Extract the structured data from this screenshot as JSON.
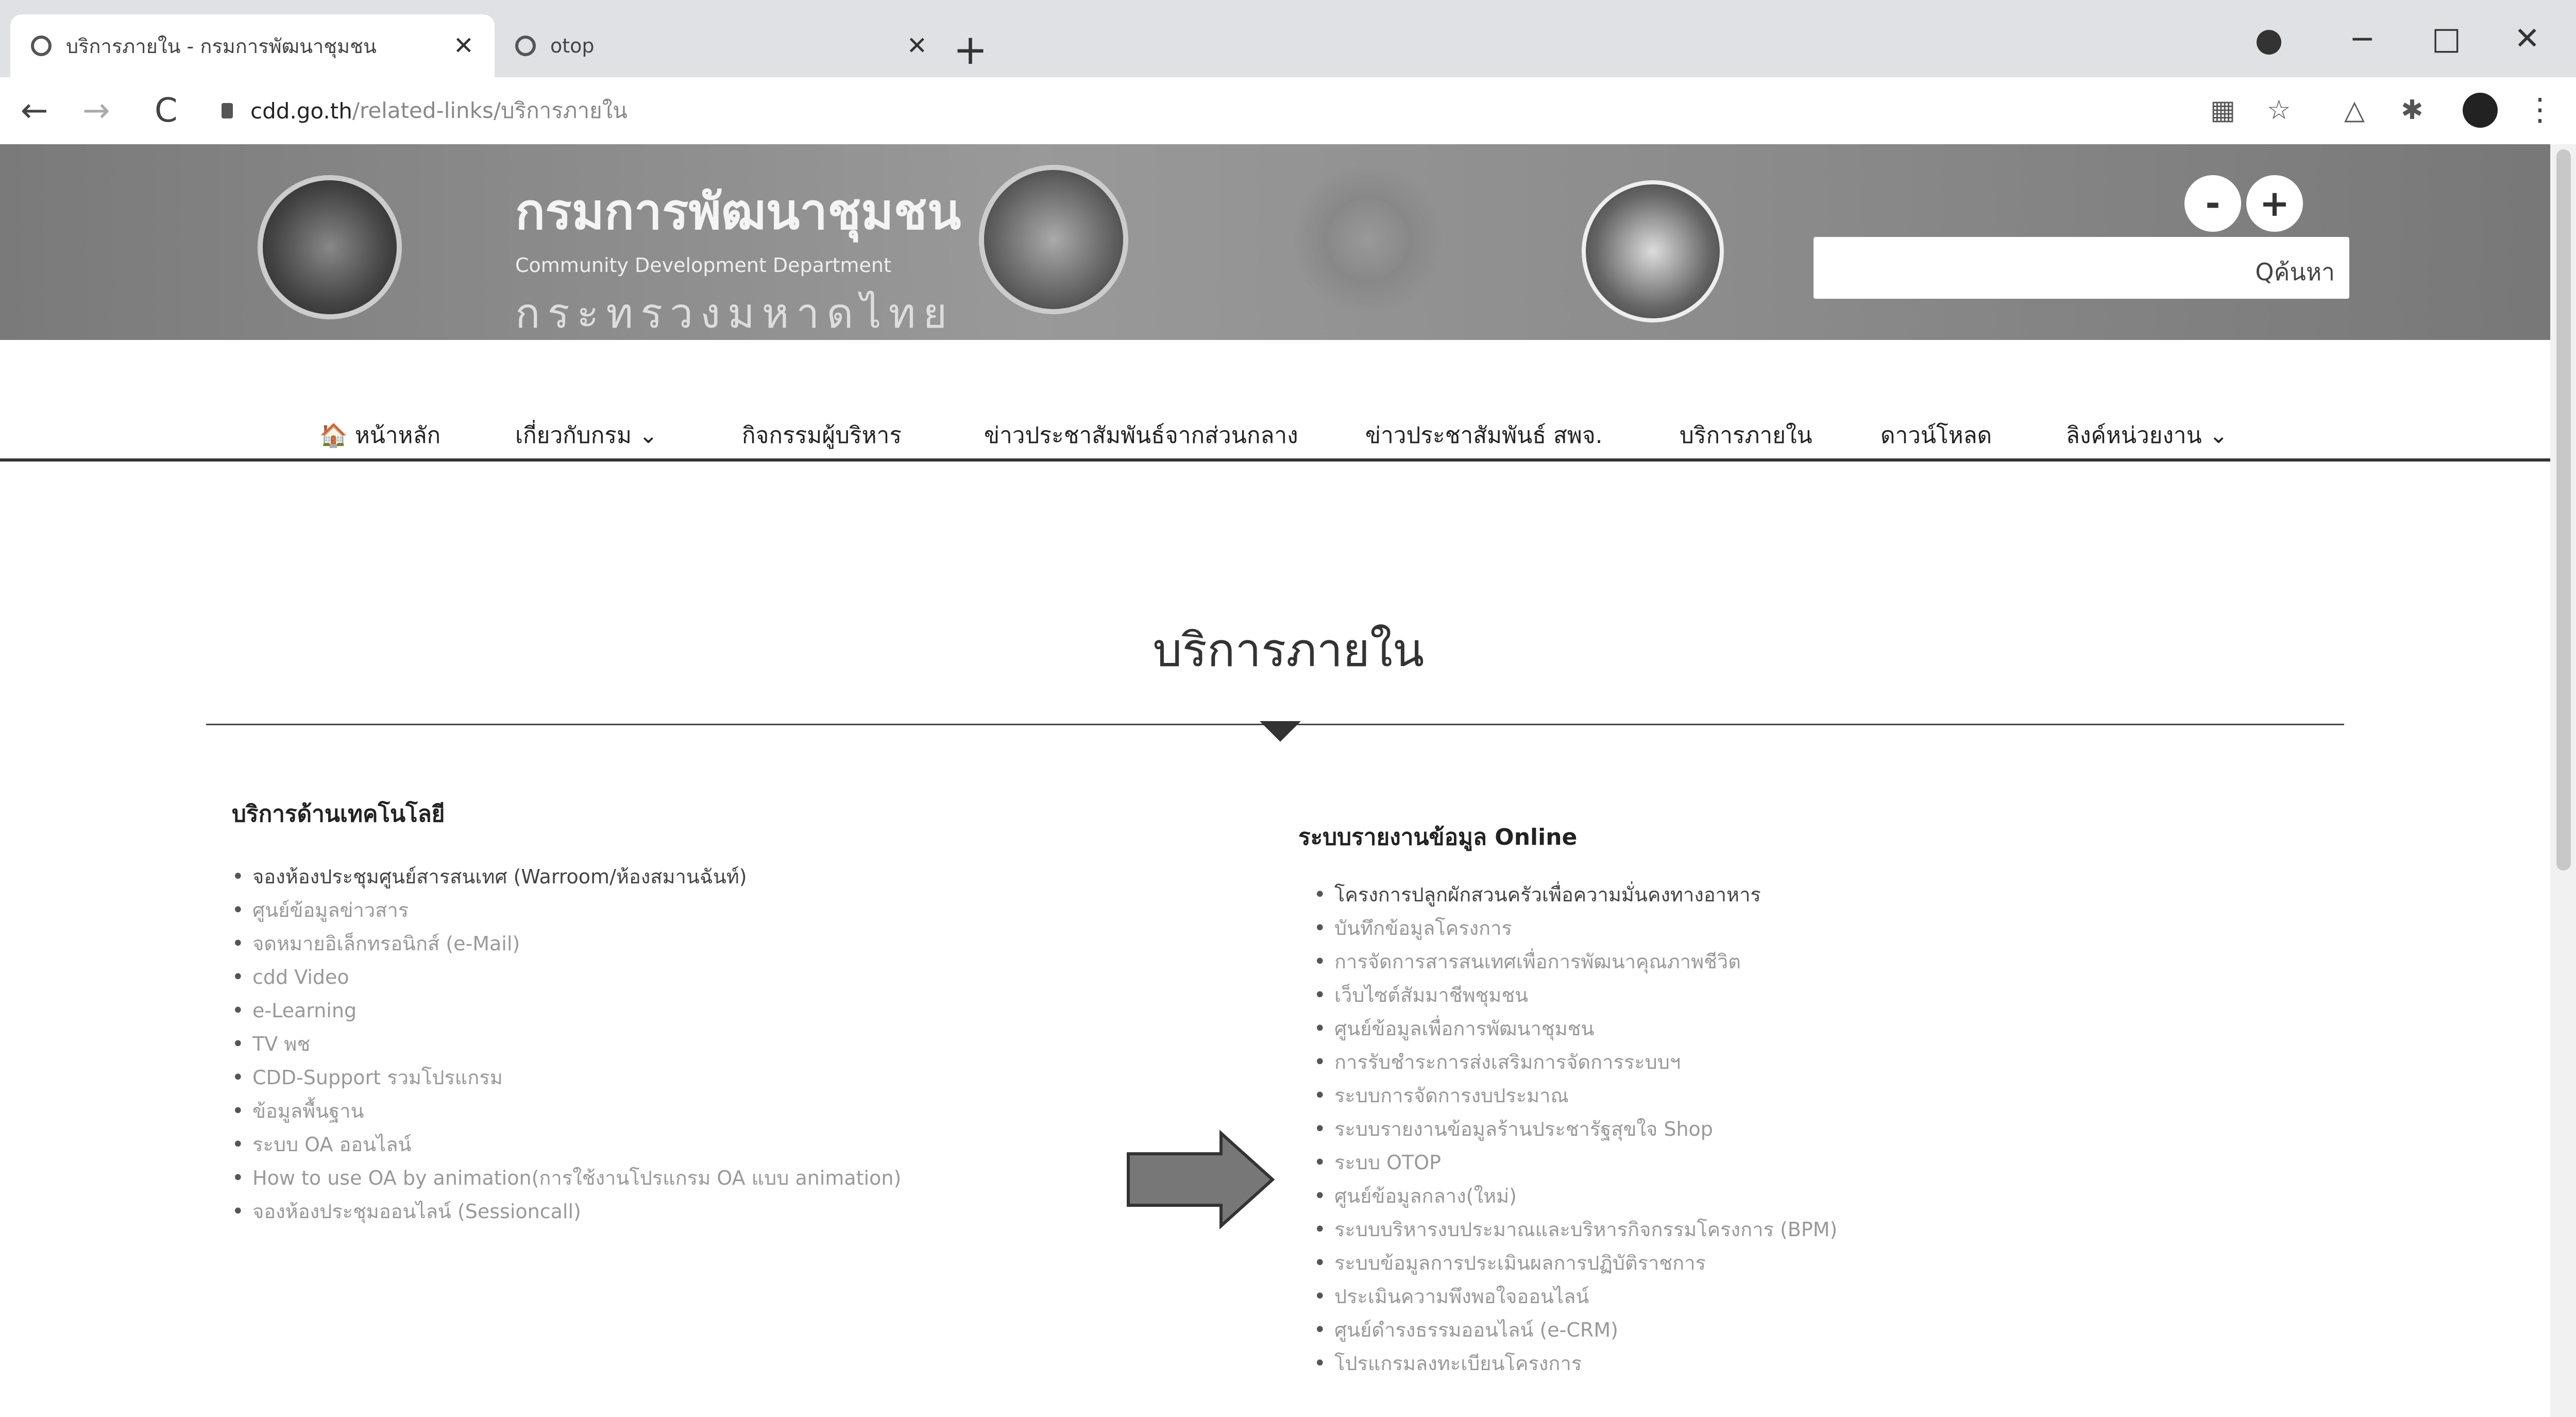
{
  "browser": {
    "tabs": [
      {
        "title": "บริการภายใน - กรมการพัฒนาชุมชน",
        "close": "✕"
      },
      {
        "title": "otop",
        "close": "✕"
      }
    ],
    "new_tab": "+",
    "url_host": "cdd.go.th",
    "url_path": "/related-links/บริการภายใน",
    "back": "←",
    "forward": "→",
    "reload": "C",
    "win_min": "−",
    "win_max": "□",
    "win_close": "✕",
    "menu": "⋮"
  },
  "header": {
    "org_name_th": "กรมการพัฒนาชุมชน",
    "org_name_en": "Community Development Department",
    "ministry": "กระทรวงมหาดไทย",
    "font_minus": "-",
    "font_plus": "+",
    "search_button": "Qค้นหา"
  },
  "nav": {
    "items": [
      "🏠 หน้าหลัก",
      "เกี่ยวกับกรม ⌄",
      "กิจกรรมผู้บริหาร",
      "ข่าวประชาสัมพันธ์จากส่วนกลาง",
      "ข่าวประชาสัมพันธ์ สพจ.",
      "บริการภายใน",
      "ดาวน์โหลด",
      "ลิงค์หน่วยงาน ⌄"
    ]
  },
  "page": {
    "title": "บริการภายใน",
    "left_section": {
      "heading": "บริการด้านเทคโนโลยี",
      "items": [
        "จองห้องประชุมศูนย์สารสนเทศ (Warroom/ห้องสมานฉันท์)",
        "ศูนย์ข้อมูลข่าวสาร",
        "จดหมายอิเล็กทรอนิกส์ (e-Mail)",
        "cdd Video",
        "e-Learning",
        "TV พช",
        "CDD-Support รวมโปรแกรม",
        "ข้อมูลพื้นฐาน",
        "ระบบ OA ออนไลน์",
        "How to use OA by animation(การใช้งานโปรแกรม OA แบบ animation)",
        "จองห้องประชุมออนไลน์ (Sessioncall)"
      ]
    },
    "right_section": {
      "heading": "ระบบรายงานข้อมูล Online",
      "items": [
        "โครงการปลูกผักสวนครัวเพื่อความมั่นคงทางอาหาร",
        "บันทึกข้อมูลโครงการ",
        "การจัดการสารสนเทศเพื่อการพัฒนาคุณภาพชีวิต",
        "เว็บไซต์สัมมาชีพชุมชน",
        "ศูนย์ข้อมูลเพื่อการพัฒนาชุมชน",
        "การรับชำระการส่งเสริมการจัดการระบบฯ",
        "ระบบการจัดการงบประมาณ",
        "ระบบรายงานข้อมูลร้านประชารัฐสุขใจ Shop",
        "ระบบ OTOP",
        "ศูนย์ข้อมูลกลาง(ใหม่)",
        "ระบบบริหารงบประมาณและบริหารกิจกรรมโครงการ (BPM)",
        "ระบบข้อมูลการประเมินผลการปฏิบัติราชการ",
        "ประเมินความพึงพอใจออนไลน์",
        "ศูนย์ดำรงธรรมออนไลน์ (e-CRM)",
        "โปรแกรมลงทะเบียนโครงการ"
      ]
    }
  }
}
